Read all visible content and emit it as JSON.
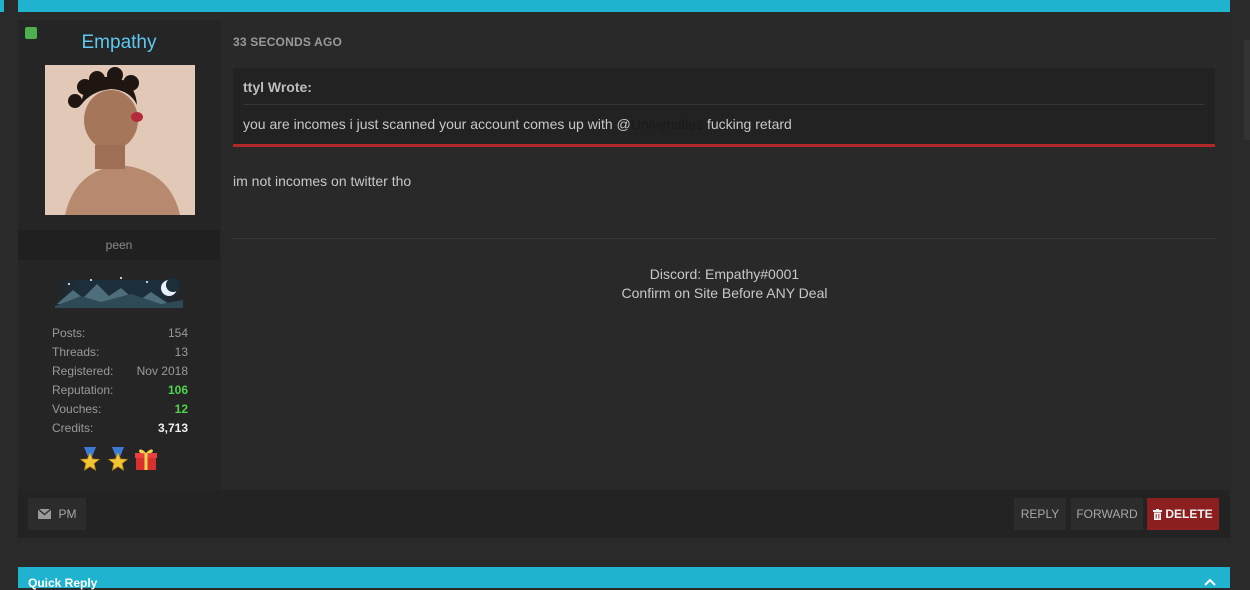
{
  "author": {
    "username": "Empathy",
    "user_title": "peen",
    "stats": [
      {
        "label": "Posts:",
        "value": "154"
      },
      {
        "label": "Threads:",
        "value": "13"
      },
      {
        "label": "Registered:",
        "value": "Nov 2018"
      },
      {
        "label": "Reputation:",
        "value": "106"
      },
      {
        "label": "Vouches:",
        "value": "12"
      },
      {
        "label": "Credits:",
        "value": "3,713"
      }
    ],
    "awards": [
      "ribbon-star-icon",
      "ribbon-star-icon",
      "gift-icon"
    ],
    "colors": {
      "username": "#5ec9f0",
      "online": "#4caf50",
      "positive": "#4fd24f"
    }
  },
  "post": {
    "timestamp": "33 SECONDS AGO",
    "quote": {
      "author": "ttyl Wrote:",
      "text_before": "you are incomes i just scanned your account comes up with @",
      "mention": "Universities",
      "text_after": " fucking retard"
    },
    "body": "im not incomes on twitter tho",
    "signature": {
      "line1": "Discord: Empathy#0001",
      "line2": "Confirm on Site Before ANY Deal"
    }
  },
  "actions": {
    "pm": "PM",
    "reply": "REPLY",
    "forward": "FORWARD",
    "delete": "DELETE"
  },
  "quick_reply": {
    "title": "Quick Reply"
  },
  "colors": {
    "accent": "#1fb3cf",
    "danger": "#8c1f1f",
    "quote_border": "#b02828"
  }
}
